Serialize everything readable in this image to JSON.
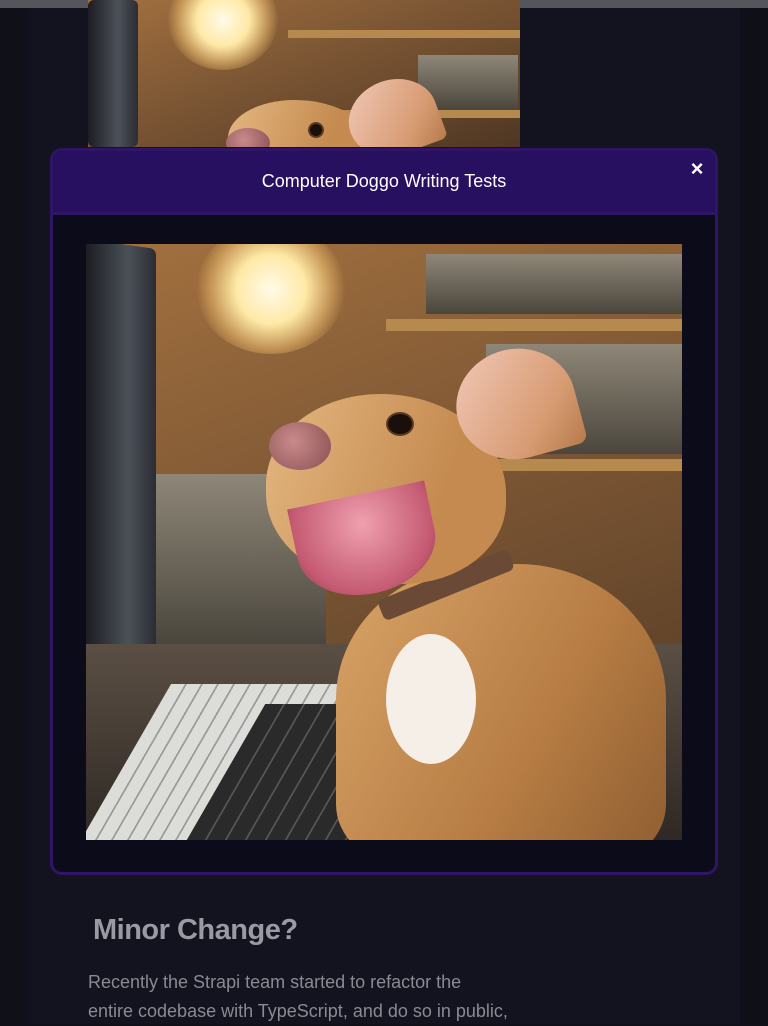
{
  "modal": {
    "title": "Computer Doggo Writing Tests",
    "close_label": "×"
  },
  "article": {
    "heading": "Minor Change?",
    "paragraph_lines": [
      "Recently the Strapi team started to refactor the",
      "entire codebase with TypeScript, and do so in public,"
    ]
  },
  "colors": {
    "page_bg": "#13131f",
    "modal_header": "#281060",
    "modal_border": "#2e1565",
    "modal_body": "#0c0b1a"
  }
}
